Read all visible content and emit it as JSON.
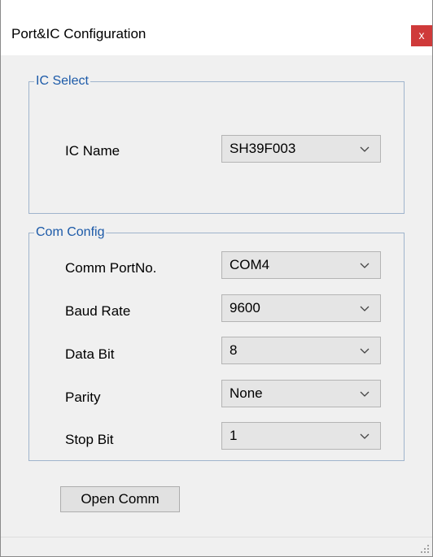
{
  "window": {
    "title": "Port&IC Configuration",
    "close_label": "x"
  },
  "ic_select": {
    "legend": "IC Select",
    "ic_name_label": "IC Name",
    "ic_name_value": "SH39F003"
  },
  "com_config": {
    "legend": "Com Config",
    "fields": [
      {
        "label": "Comm PortNo.",
        "value": "COM4"
      },
      {
        "label": "Baud Rate",
        "value": "9600"
      },
      {
        "label": "Data Bit",
        "value": "8"
      },
      {
        "label": "Parity",
        "value": "None"
      },
      {
        "label": "Stop Bit",
        "value": "1"
      }
    ]
  },
  "actions": {
    "open_comm_label": "Open Comm"
  },
  "icons": {
    "dropdown": "chevron-down-icon",
    "close": "close-icon",
    "resize": "resize-grip-icon"
  },
  "colors": {
    "window_bg": "#f0f0f0",
    "close_bg": "#cf3a3a",
    "legend_text": "#1c5aa8",
    "group_border": "#9fb4cc",
    "combo_bg": "#e5e5e5"
  }
}
